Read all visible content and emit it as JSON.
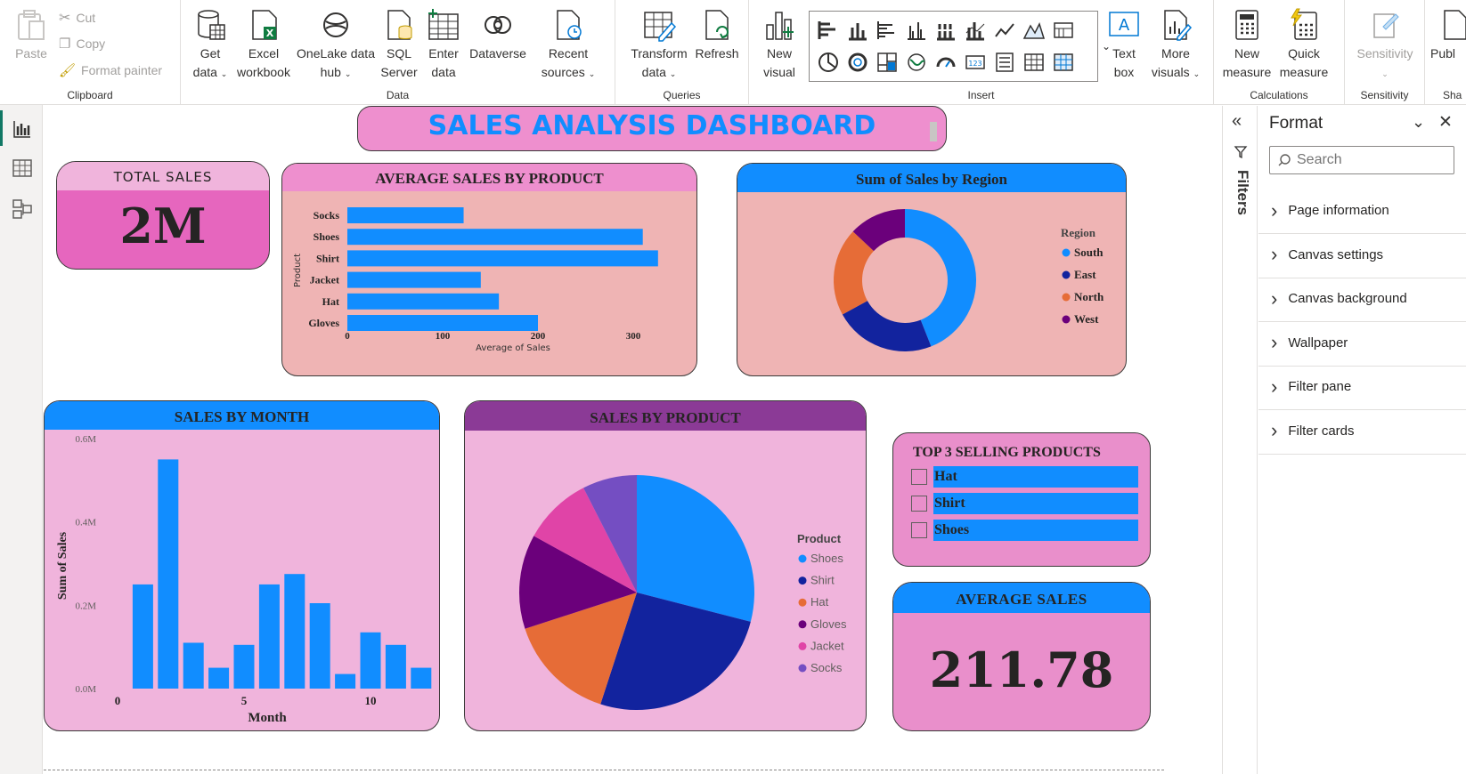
{
  "ribbon": {
    "clipboard": {
      "paste": "Paste",
      "cut": "Cut",
      "copy": "Copy",
      "format_painter": "Format painter",
      "group_label": "Clipboard"
    },
    "data": {
      "get_data": [
        "Get",
        "data"
      ],
      "excel": [
        "Excel",
        "workbook"
      ],
      "onelake": [
        "OneLake data",
        "hub"
      ],
      "sql": [
        "SQL",
        "Server"
      ],
      "enter": [
        "Enter",
        "data"
      ],
      "dataverse": "Dataverse",
      "recent": [
        "Recent",
        "sources"
      ],
      "group_label": "Data"
    },
    "queries": {
      "transform": [
        "Transform",
        "data"
      ],
      "refresh": "Refresh",
      "group_label": "Queries"
    },
    "insert": {
      "new_visual": [
        "New",
        "visual"
      ],
      "text_box": [
        "Text",
        "box"
      ],
      "more_visuals": [
        "More",
        "visuals"
      ],
      "group_label": "Insert"
    },
    "calculations": {
      "new_measure": [
        "New",
        "measure"
      ],
      "quick_measure": [
        "Quick",
        "measure"
      ],
      "group_label": "Calculations"
    },
    "sensitivity": {
      "label": "Sensitivity",
      "group_label": "Sensitivity"
    },
    "share": {
      "publish": "Publ",
      "group_label": "Sha"
    }
  },
  "dashboard": {
    "title": "SALES ANALYSIS DASHBOARD",
    "total_sales": {
      "label": "TOTAL SALES",
      "value": "2M"
    },
    "average_sales": {
      "label": "AVERAGE SALES",
      "value": "211.78"
    },
    "top3": {
      "title": "TOP 3 SELLING PRODUCTS",
      "items": [
        "Hat",
        "Shirt",
        "Shoes"
      ]
    }
  },
  "chart_data": [
    {
      "type": "bar",
      "orientation": "horizontal",
      "title": "AVERAGE SALES BY PRODUCT",
      "categories": [
        "Socks",
        "Shoes",
        "Shirt",
        "Jacket",
        "Hat",
        "Gloves"
      ],
      "values": [
        122,
        310,
        326,
        140,
        159,
        200
      ],
      "xlabel": "Average of Sales",
      "ylabel": "Product",
      "xticks": [
        "0",
        "100",
        "200",
        "300"
      ],
      "xlim": [
        0,
        350
      ],
      "color": "#118DFF"
    },
    {
      "type": "pie",
      "donut": true,
      "title": "Sum of Sales by Region",
      "legend_title": "Region",
      "labels": [
        "South",
        "East",
        "North",
        "West"
      ],
      "values": [
        44,
        23,
        20,
        13
      ],
      "colors": [
        "#118DFF",
        "#12239E",
        "#E66C37",
        "#6B007B"
      ]
    },
    {
      "type": "bar",
      "title": "SALES BY MONTH",
      "x": [
        1,
        2,
        3,
        4,
        5,
        6,
        7,
        8,
        9,
        10,
        11,
        12
      ],
      "values": [
        0.25,
        0.55,
        0.11,
        0.05,
        0.105,
        0.25,
        0.275,
        0.205,
        0.035,
        0.135,
        0.105,
        0.05
      ],
      "xlabel": "Month",
      "ylabel": "Sum of Sales",
      "yticks": [
        "0.0M",
        "0.2M",
        "0.4M",
        "0.6M"
      ],
      "xticks": [
        "0",
        "5",
        "10"
      ],
      "ylim": [
        0,
        0.6
      ],
      "color": "#118DFF"
    },
    {
      "type": "pie",
      "title": "SALES BY PRODUCT",
      "legend_title": "Product",
      "labels": [
        "Shoes",
        "Shirt",
        "Hat",
        "Gloves",
        "Jacket",
        "Socks"
      ],
      "values": [
        29,
        26,
        15,
        13,
        9.5,
        7.5
      ],
      "colors": [
        "#118DFF",
        "#12239E",
        "#E66C37",
        "#6B007B",
        "#E044A7",
        "#744EC2"
      ]
    }
  ],
  "colors": {
    "blue": "#118DFF",
    "card_pink": "#E666BE",
    "panel_pink": "#EFB4B4",
    "light_pink": "#F0B4DC",
    "title_blue_text": "#118DFF",
    "purple_header": "#8B3A96"
  },
  "filters_pane": {
    "label": "Filters"
  },
  "format_pane": {
    "title": "Format",
    "search_placeholder": "Search",
    "sections": [
      "Page information",
      "Canvas settings",
      "Canvas background",
      "Wallpaper",
      "Filter pane",
      "Filter cards"
    ]
  }
}
